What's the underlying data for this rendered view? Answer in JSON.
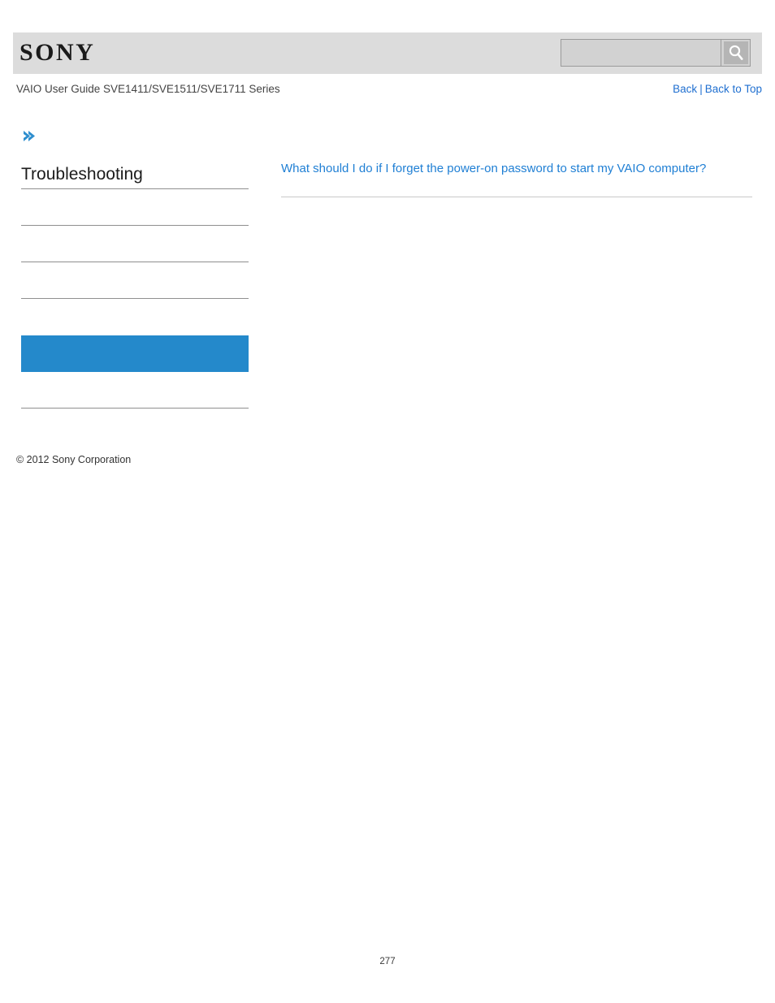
{
  "header": {
    "logo_text": "SONY",
    "logo_icon": "sony-wordmark"
  },
  "search": {
    "value": "",
    "placeholder": "",
    "button_icon": "search-icon"
  },
  "title_bar": {
    "guide_title": "VAIO User Guide SVE1411/SVE1511/SVE1711 Series",
    "back_label": "Back",
    "separator": "|",
    "back_to_top_label": "Back to Top"
  },
  "sidebar": {
    "marker_icon": "double-chevron-right-icon",
    "heading": "Troubleshooting",
    "items": [
      {
        "label": "",
        "active": false
      },
      {
        "label": "",
        "active": false
      },
      {
        "label": "",
        "active": false
      },
      {
        "label": "",
        "active": false
      },
      {
        "label": "",
        "active": true
      },
      {
        "label": "",
        "active": false
      }
    ]
  },
  "main": {
    "links": [
      {
        "label": "What should I do if I forget the power-on password to start my VAIO computer?"
      }
    ]
  },
  "footer": {
    "copyright": "© 2012 Sony Corporation",
    "page_number": "277"
  },
  "colors": {
    "accent_blue": "#2489cb",
    "link_blue": "#1f7fd4",
    "header_band": "#dcdcdc",
    "divider": "#8f8f8f"
  }
}
